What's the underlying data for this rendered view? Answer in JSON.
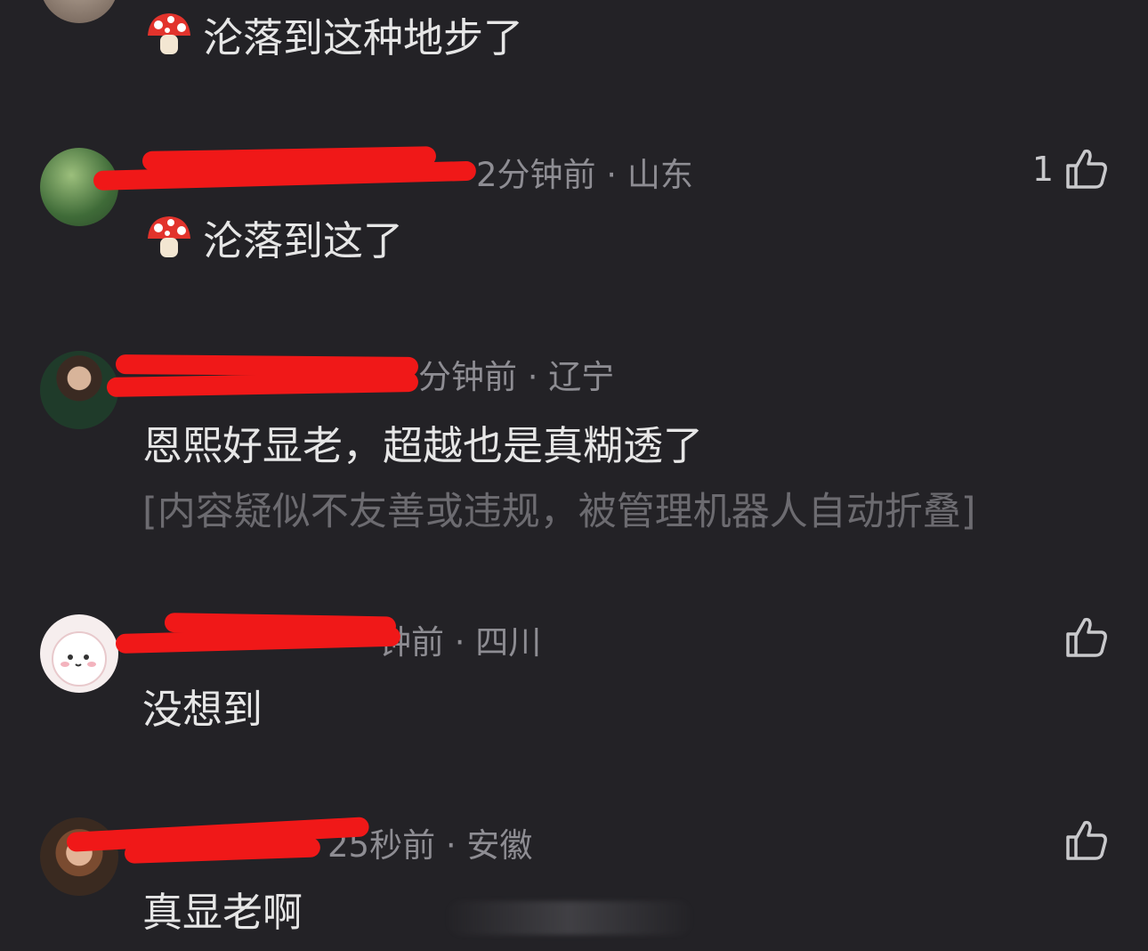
{
  "comments": [
    {
      "time_location": "",
      "text": "沦落到这种地步了",
      "has_emoji": true,
      "likes": ""
    },
    {
      "time_location": "2分钟前 · 山东",
      "text": "沦落到这了",
      "has_emoji": true,
      "likes": "1"
    },
    {
      "time_location": "分钟前 · 辽宁",
      "text": "恩熙好显老，超越也是真糊透了",
      "folded_notice": "[内容疑似不友善或违规，被管理机器人自动折叠]",
      "likes": ""
    },
    {
      "time_location": "钟前 · 四川",
      "text": "没想到",
      "likes": ""
    },
    {
      "time_location": "25秒前 · 安徽",
      "text": "真显老啊",
      "likes": ""
    }
  ],
  "icons": {
    "emoji": "mushroom-icon",
    "like": "thumbs-up-icon"
  },
  "colors": {
    "background": "#232226",
    "redaction": "#f01818",
    "meta_text": "#8e8d93",
    "folded_text": "#6c6b70"
  }
}
